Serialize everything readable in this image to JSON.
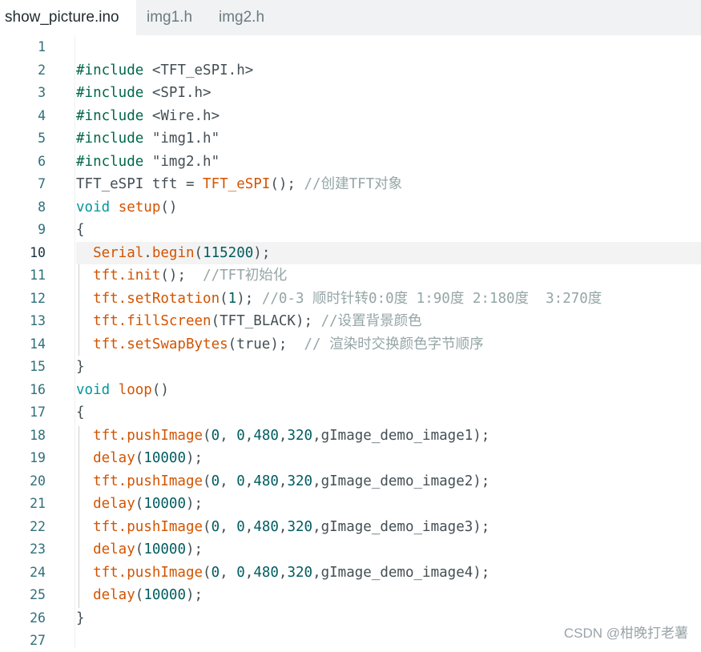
{
  "tabs": [
    {
      "label": "show_picture.ino",
      "active": true
    },
    {
      "label": "img1.h",
      "active": false
    },
    {
      "label": "img2.h",
      "active": false
    }
  ],
  "editor": {
    "current_line": 10,
    "lines": [
      {
        "n": "1",
        "tokens": []
      },
      {
        "n": "2",
        "tokens": [
          {
            "t": "#include",
            "c": "pp"
          },
          {
            "t": " <TFT_eSPI.h>",
            "c": "def"
          }
        ]
      },
      {
        "n": "3",
        "tokens": [
          {
            "t": "#include",
            "c": "pp"
          },
          {
            "t": " <SPI.h>",
            "c": "def"
          }
        ]
      },
      {
        "n": "4",
        "tokens": [
          {
            "t": "#include",
            "c": "pp"
          },
          {
            "t": " <Wire.h>",
            "c": "def"
          }
        ]
      },
      {
        "n": "5",
        "tokens": [
          {
            "t": "#include",
            "c": "pp"
          },
          {
            "t": " \"img1.h\"",
            "c": "def"
          }
        ]
      },
      {
        "n": "6",
        "tokens": [
          {
            "t": "#include",
            "c": "pp"
          },
          {
            "t": " \"img2.h\"",
            "c": "def"
          }
        ]
      },
      {
        "n": "7",
        "tokens": [
          {
            "t": "TFT_eSPI tft = ",
            "c": "def"
          },
          {
            "t": "TFT_eSPI",
            "c": "fn"
          },
          {
            "t": "(); ",
            "c": "def"
          },
          {
            "t": "//创建TFT对象",
            "c": "cm"
          }
        ]
      },
      {
        "n": "8",
        "tokens": [
          {
            "t": "void",
            "c": "kw"
          },
          {
            "t": " ",
            "c": "def"
          },
          {
            "t": "setup",
            "c": "fn"
          },
          {
            "t": "()",
            "c": "def"
          }
        ]
      },
      {
        "n": "9",
        "tokens": [
          {
            "t": "{",
            "c": "def"
          }
        ]
      },
      {
        "n": "10",
        "tokens": [
          {
            "t": "  ",
            "c": "def"
          },
          {
            "t": "Serial",
            "c": "fn"
          },
          {
            "t": ".",
            "c": "def"
          },
          {
            "t": "begin",
            "c": "fn"
          },
          {
            "t": "(",
            "c": "def"
          },
          {
            "t": "115200",
            "c": "num"
          },
          {
            "t": ");",
            "c": "def"
          }
        ]
      },
      {
        "n": "11",
        "tokens": [
          {
            "t": "  ",
            "c": "def"
          },
          {
            "t": "tft.init",
            "c": "fn"
          },
          {
            "t": "();  ",
            "c": "def"
          },
          {
            "t": "//TFT初始化",
            "c": "cm"
          }
        ]
      },
      {
        "n": "12",
        "tokens": [
          {
            "t": "  ",
            "c": "def"
          },
          {
            "t": "tft.setRotation",
            "c": "fn"
          },
          {
            "t": "(",
            "c": "def"
          },
          {
            "t": "1",
            "c": "num"
          },
          {
            "t": "); ",
            "c": "def"
          },
          {
            "t": "//0-3 顺时针转0:0度 1:90度 2:180度  3:270度",
            "c": "cm"
          }
        ]
      },
      {
        "n": "13",
        "tokens": [
          {
            "t": "  ",
            "c": "def"
          },
          {
            "t": "tft.fillScreen",
            "c": "fn"
          },
          {
            "t": "(TFT_BLACK); ",
            "c": "def"
          },
          {
            "t": "//设置背景颜色",
            "c": "cm"
          }
        ]
      },
      {
        "n": "14",
        "tokens": [
          {
            "t": "  ",
            "c": "def"
          },
          {
            "t": "tft.setSwapBytes",
            "c": "fn"
          },
          {
            "t": "(true);  ",
            "c": "def"
          },
          {
            "t": "// 渲染时交换颜色字节顺序",
            "c": "cm"
          }
        ]
      },
      {
        "n": "15",
        "tokens": [
          {
            "t": "}",
            "c": "def"
          }
        ]
      },
      {
        "n": "16",
        "tokens": [
          {
            "t": "void",
            "c": "kw"
          },
          {
            "t": " ",
            "c": "def"
          },
          {
            "t": "loop",
            "c": "fn"
          },
          {
            "t": "()",
            "c": "def"
          }
        ]
      },
      {
        "n": "17",
        "tokens": [
          {
            "t": "{",
            "c": "def"
          }
        ]
      },
      {
        "n": "18",
        "tokens": [
          {
            "t": "  ",
            "c": "def"
          },
          {
            "t": "tft.pushImage",
            "c": "fn"
          },
          {
            "t": "(",
            "c": "def"
          },
          {
            "t": "0",
            "c": "num"
          },
          {
            "t": ", ",
            "c": "def"
          },
          {
            "t": "0",
            "c": "num"
          },
          {
            "t": ",",
            "c": "def"
          },
          {
            "t": "480",
            "c": "num"
          },
          {
            "t": ",",
            "c": "def"
          },
          {
            "t": "320",
            "c": "num"
          },
          {
            "t": ",gImage_demo_image1);",
            "c": "def"
          }
        ]
      },
      {
        "n": "19",
        "tokens": [
          {
            "t": "  ",
            "c": "def"
          },
          {
            "t": "delay",
            "c": "fn"
          },
          {
            "t": "(",
            "c": "def"
          },
          {
            "t": "10000",
            "c": "num"
          },
          {
            "t": ");",
            "c": "def"
          }
        ]
      },
      {
        "n": "20",
        "tokens": [
          {
            "t": "  ",
            "c": "def"
          },
          {
            "t": "tft.pushImage",
            "c": "fn"
          },
          {
            "t": "(",
            "c": "def"
          },
          {
            "t": "0",
            "c": "num"
          },
          {
            "t": ", ",
            "c": "def"
          },
          {
            "t": "0",
            "c": "num"
          },
          {
            "t": ",",
            "c": "def"
          },
          {
            "t": "480",
            "c": "num"
          },
          {
            "t": ",",
            "c": "def"
          },
          {
            "t": "320",
            "c": "num"
          },
          {
            "t": ",gImage_demo_image2);",
            "c": "def"
          }
        ]
      },
      {
        "n": "21",
        "tokens": [
          {
            "t": "  ",
            "c": "def"
          },
          {
            "t": "delay",
            "c": "fn"
          },
          {
            "t": "(",
            "c": "def"
          },
          {
            "t": "10000",
            "c": "num"
          },
          {
            "t": ");",
            "c": "def"
          }
        ]
      },
      {
        "n": "22",
        "tokens": [
          {
            "t": "  ",
            "c": "def"
          },
          {
            "t": "tft.pushImage",
            "c": "fn"
          },
          {
            "t": "(",
            "c": "def"
          },
          {
            "t": "0",
            "c": "num"
          },
          {
            "t": ", ",
            "c": "def"
          },
          {
            "t": "0",
            "c": "num"
          },
          {
            "t": ",",
            "c": "def"
          },
          {
            "t": "480",
            "c": "num"
          },
          {
            "t": ",",
            "c": "def"
          },
          {
            "t": "320",
            "c": "num"
          },
          {
            "t": ",gImage_demo_image3);",
            "c": "def"
          }
        ]
      },
      {
        "n": "23",
        "tokens": [
          {
            "t": "  ",
            "c": "def"
          },
          {
            "t": "delay",
            "c": "fn"
          },
          {
            "t": "(",
            "c": "def"
          },
          {
            "t": "10000",
            "c": "num"
          },
          {
            "t": ");",
            "c": "def"
          }
        ]
      },
      {
        "n": "24",
        "tokens": [
          {
            "t": "  ",
            "c": "def"
          },
          {
            "t": "tft.pushImage",
            "c": "fn"
          },
          {
            "t": "(",
            "c": "def"
          },
          {
            "t": "0",
            "c": "num"
          },
          {
            "t": ", ",
            "c": "def"
          },
          {
            "t": "0",
            "c": "num"
          },
          {
            "t": ",",
            "c": "def"
          },
          {
            "t": "480",
            "c": "num"
          },
          {
            "t": ",",
            "c": "def"
          },
          {
            "t": "320",
            "c": "num"
          },
          {
            "t": ",gImage_demo_image4);",
            "c": "def"
          }
        ]
      },
      {
        "n": "25",
        "tokens": [
          {
            "t": "  ",
            "c": "def"
          },
          {
            "t": "delay",
            "c": "fn"
          },
          {
            "t": "(",
            "c": "def"
          },
          {
            "t": "10000",
            "c": "num"
          },
          {
            "t": ");",
            "c": "def"
          }
        ]
      },
      {
        "n": "26",
        "tokens": [
          {
            "t": "}",
            "c": "def"
          }
        ]
      },
      {
        "n": "27",
        "tokens": []
      }
    ]
  },
  "watermark": "CSDN @柑晚打老薯"
}
